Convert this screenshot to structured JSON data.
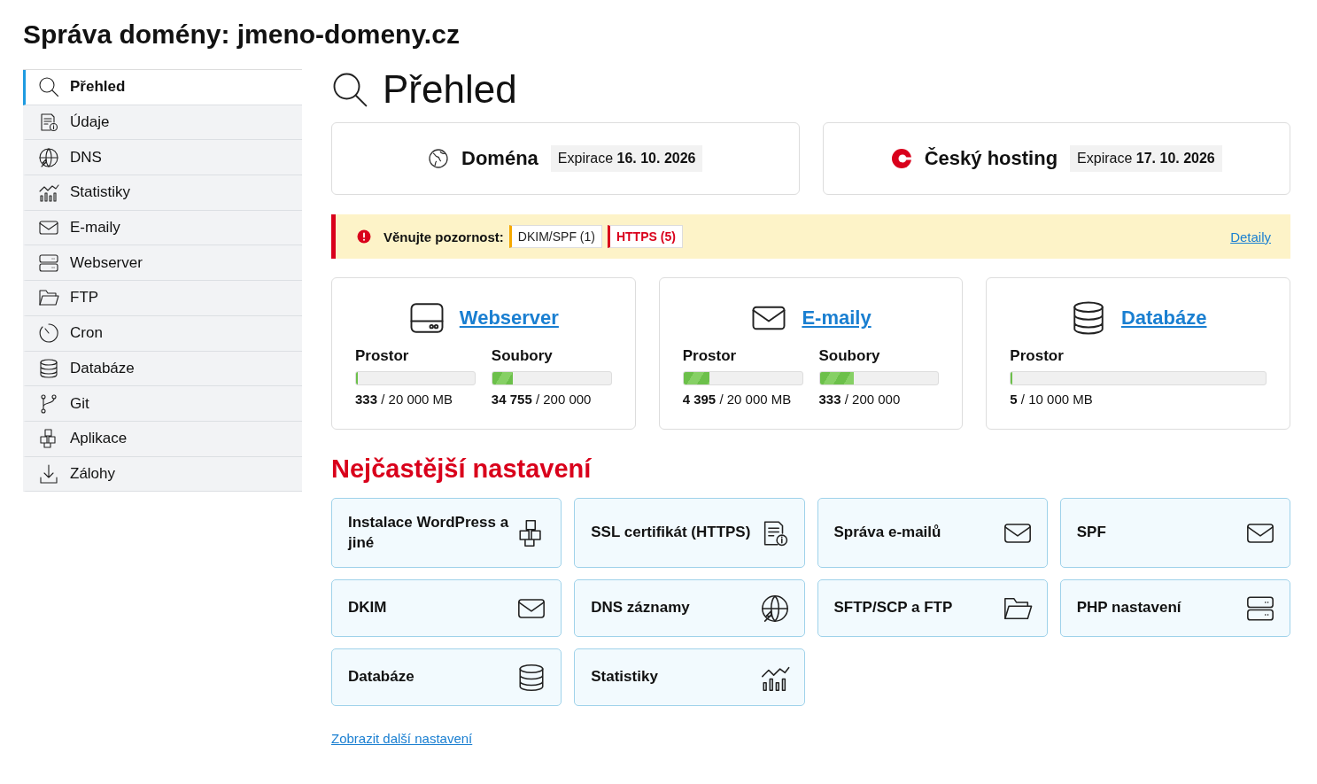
{
  "page_title": "Správa domény: jmeno-domeny.cz",
  "sidebar": {
    "items": [
      {
        "label": "Přehled",
        "selected": true
      },
      {
        "label": "Údaje",
        "selected": false
      },
      {
        "label": "DNS",
        "selected": false
      },
      {
        "label": "Statistiky",
        "selected": false
      },
      {
        "label": "E-maily",
        "selected": false
      },
      {
        "label": "Webserver",
        "selected": false
      },
      {
        "label": "FTP",
        "selected": false
      },
      {
        "label": "Cron",
        "selected": false
      },
      {
        "label": "Databáze",
        "selected": false
      },
      {
        "label": "Git",
        "selected": false
      },
      {
        "label": "Aplikace",
        "selected": false
      },
      {
        "label": "Zálohy",
        "selected": false
      }
    ]
  },
  "heading": "Přehled",
  "services": [
    {
      "kind": "domain",
      "name": "Doména",
      "expiry": "Expirace **16. 10. 2026**"
    },
    {
      "kind": "hosting",
      "name": "Český hosting",
      "expiry": "Expirace **17. 10. 2026**"
    }
  ],
  "alert": {
    "label": "Věnujte pozornost:",
    "tags": [
      {
        "kind": "warning",
        "text": "DKIM/SPF (1)"
      },
      {
        "kind": "error",
        "text": "HTTPS (5)"
      }
    ],
    "link": "Detaily"
  },
  "usage_cards": [
    {
      "title": "Webserver",
      "meters": [
        {
          "label": "Prostor",
          "level": 0.015,
          "reading": "**333** / 20 000 MB"
        },
        {
          "label": "Soubory",
          "level": 0.17,
          "reading": "**34 755** / 200 000"
        }
      ]
    },
    {
      "title": "E-maily",
      "meters": [
        {
          "label": "Prostor",
          "level": 0.22,
          "reading": "**4 395** / 20 000 MB"
        },
        {
          "label": "Soubory",
          "level": 0.29,
          "reading": "**333** / 200 000"
        }
      ]
    },
    {
      "title": "Databáze",
      "meters": [
        {
          "label": "Prostor",
          "level": 0.005,
          "reading": "**5** / 10 000 MB"
        }
      ]
    }
  ],
  "settings_heading": "Nejčastější nastavení",
  "settings": [
    {
      "label": "Instalace WordPress a jiné"
    },
    {
      "label": "SSL certifikát (HTTPS)"
    },
    {
      "label": "Správa e-mailů"
    },
    {
      "label": "SPF"
    },
    {
      "label": "DKIM"
    },
    {
      "label": "DNS záznamy"
    },
    {
      "label": "SFTP/SCP a FTP"
    },
    {
      "label": "PHP nastavení"
    },
    {
      "label": "Databáze"
    },
    {
      "label": "Statistiky"
    }
  ],
  "more_link": "Zobrazit další nastavení"
}
